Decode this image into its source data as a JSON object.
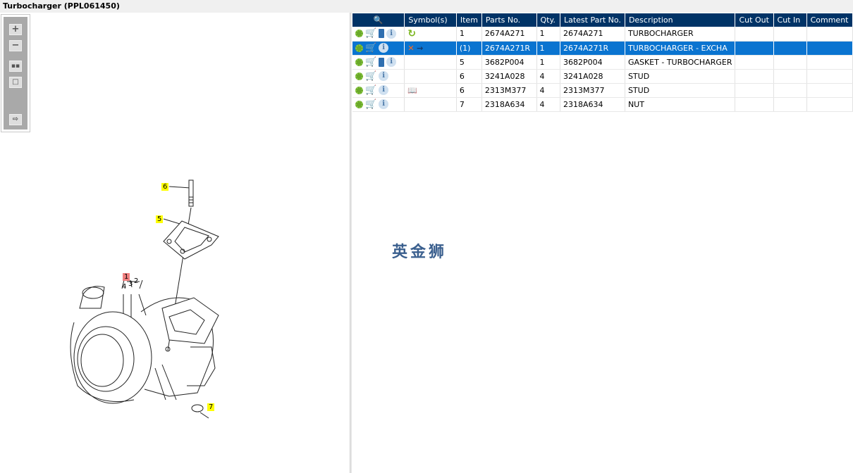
{
  "title": "Turbocharger (PPL061450)",
  "toolbar": {
    "zoom_in": "+",
    "zoom_out": "−",
    "fit": "fit-all-icon",
    "single": "single-view-icon",
    "export": "export-icon"
  },
  "callouts": {
    "c1": "1",
    "c2": "2",
    "c3": "3",
    "c4": "4",
    "c5": "5",
    "c6": "6",
    "c7": "7"
  },
  "table": {
    "headers": {
      "icons": "magnifier-icon",
      "symbols": "Symbol(s)",
      "item": "Item",
      "parts_no": "Parts No.",
      "qty": "Qty.",
      "latest": "Latest Part No.",
      "description": "Description",
      "cut_out": "Cut Out",
      "cut_in": "Cut In",
      "comment": "Comment"
    },
    "rows": [
      {
        "item": "1",
        "parts_no": "2674A271",
        "qty": "1",
        "latest": "2674A271",
        "description": "TURBOCHARGER",
        "symbol": "refresh-icon",
        "book": true,
        "selected": false
      },
      {
        "item": "(1)",
        "parts_no": "2674A271R",
        "qty": "1",
        "latest": "2674A271R",
        "description": "TURBOCHARGER - EXCHA",
        "symbol": "replace-icon",
        "book": false,
        "selected": true
      },
      {
        "item": "5",
        "parts_no": "3682P004",
        "qty": "1",
        "latest": "3682P004",
        "description": "GASKET - TURBOCHARGER",
        "symbol": "",
        "book": true,
        "selected": false
      },
      {
        "item": "6",
        "parts_no": "3241A028",
        "qty": "4",
        "latest": "3241A028",
        "description": "STUD",
        "symbol": "",
        "book": false,
        "selected": false
      },
      {
        "item": "6",
        "parts_no": "2313M377",
        "qty": "4",
        "latest": "2313M377",
        "description": "STUD",
        "symbol": "view-icon",
        "book": false,
        "selected": false
      },
      {
        "item": "7",
        "parts_no": "2318A634",
        "qty": "4",
        "latest": "2318A634",
        "description": "NUT",
        "symbol": "",
        "book": false,
        "selected": false
      }
    ]
  },
  "watermark": "英金狮"
}
